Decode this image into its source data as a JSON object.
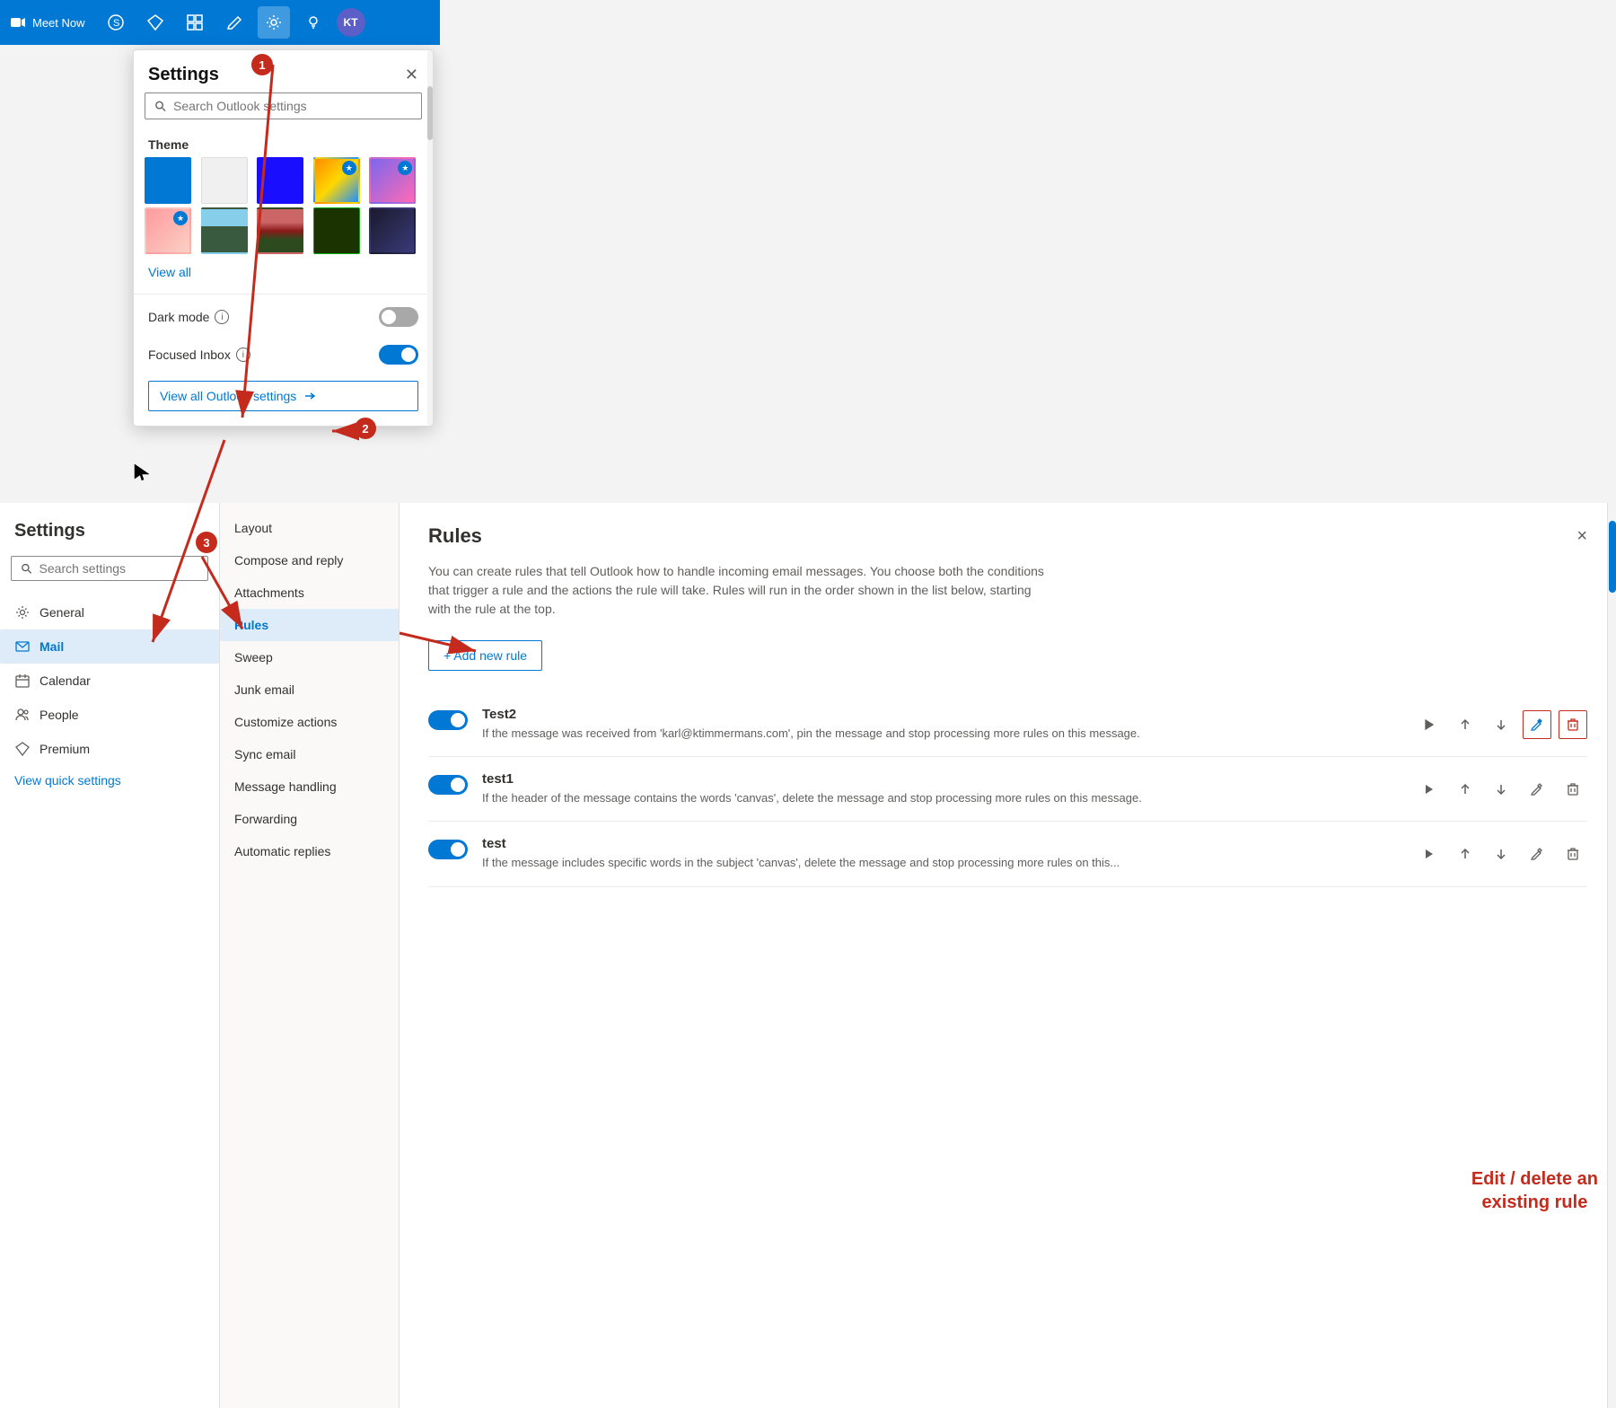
{
  "topbar": {
    "meet_now_label": "Meet Now",
    "gear_label": "Settings",
    "avatar_initials": "KT"
  },
  "quick_settings": {
    "title": "Settings",
    "search_placeholder": "Search Outlook settings",
    "theme_label": "Theme",
    "view_all_label": "View all",
    "dark_mode_label": "Dark mode",
    "focused_inbox_label": "Focused Inbox",
    "dark_mode_on": false,
    "focused_inbox_on": true,
    "view_all_settings_label": "View all Outlook settings",
    "themes": [
      {
        "id": "blue",
        "selected": true,
        "has_star": false
      },
      {
        "id": "white",
        "selected": false,
        "has_star": false
      },
      {
        "id": "royal",
        "selected": false,
        "has_star": false
      },
      {
        "id": "sunset",
        "selected": false,
        "has_star": true
      },
      {
        "id": "abstract",
        "selected": false,
        "has_star": true
      },
      {
        "id": "floral",
        "selected": false,
        "has_star": true
      },
      {
        "id": "mountains",
        "selected": false,
        "has_star": false
      },
      {
        "id": "trees",
        "selected": false,
        "has_star": false
      },
      {
        "id": "circuit",
        "selected": false,
        "has_star": false
      },
      {
        "id": "ocean",
        "selected": false,
        "has_star": false
      }
    ]
  },
  "settings_panel": {
    "title": "Settings",
    "search_placeholder": "Search settings",
    "nav_items": [
      {
        "label": "General",
        "icon": "gear",
        "active": false
      },
      {
        "label": "Mail",
        "icon": "mail",
        "active": true
      },
      {
        "label": "Calendar",
        "icon": "calendar",
        "active": false
      },
      {
        "label": "People",
        "icon": "people",
        "active": false
      },
      {
        "label": "Premium",
        "icon": "diamond",
        "active": false
      }
    ],
    "view_quick_settings": "View quick settings"
  },
  "mail_nav": {
    "items": [
      {
        "label": "Layout",
        "active": false
      },
      {
        "label": "Compose and reply",
        "active": false
      },
      {
        "label": "Attachments",
        "active": false
      },
      {
        "label": "Rules",
        "active": true
      },
      {
        "label": "Sweep",
        "active": false
      },
      {
        "label": "Junk email",
        "active": false
      },
      {
        "label": "Customize actions",
        "active": false
      },
      {
        "label": "Sync email",
        "active": false
      },
      {
        "label": "Message handling",
        "active": false
      },
      {
        "label": "Forwarding",
        "active": false
      },
      {
        "label": "Automatic replies",
        "active": false
      }
    ]
  },
  "rules": {
    "title": "Rules",
    "description": "You can create rules that tell Outlook how to handle incoming email messages. You choose both the conditions that trigger a rule and the actions the rule will take. Rules will run in the order shown in the list below, starting with the rule at the top.",
    "add_button_label": "+ Add new rule",
    "close_label": "×",
    "edit_delete_label": "Edit / delete an\nexisting rule",
    "items": [
      {
        "name": "Test2",
        "enabled": true,
        "description": "If the message was received from 'karl@ktimmermans.com', pin the message and stop processing more rules on this message."
      },
      {
        "name": "test1",
        "enabled": true,
        "description": "If the header of the message contains the words 'canvas', delete the message and stop processing more rules on this message."
      },
      {
        "name": "test",
        "enabled": true,
        "description": "If the message includes specific words in the subject 'canvas', delete the message and stop processing more rules on this..."
      }
    ]
  },
  "annotations": {
    "circle1": "1",
    "circle2": "2",
    "circle3": "3"
  }
}
